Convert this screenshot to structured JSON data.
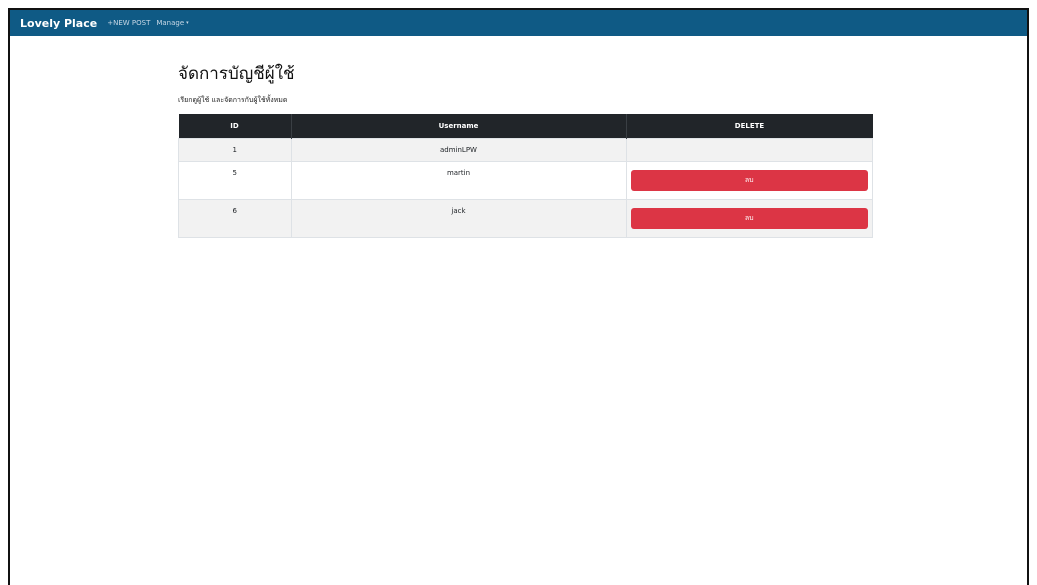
{
  "navbar": {
    "brand": "Lovely Place",
    "new_post": "+NEW POST",
    "manage": "Manage",
    "manage_caret": "▾"
  },
  "page": {
    "title": "จัดการบัญชีผู้ใช้",
    "subtitle": "เรียกดูผู้ใช้ และจัดการกับผู้ใช้ทั้งหมด"
  },
  "table": {
    "headers": [
      "ID",
      "Username",
      "DELETE"
    ],
    "rows": [
      {
        "id": "1",
        "username": "adminLPW",
        "delete_label": ""
      },
      {
        "id": "5",
        "username": "martin",
        "delete_label": "ลบ"
      },
      {
        "id": "6",
        "username": "jack",
        "delete_label": "ลบ"
      }
    ]
  },
  "colors": {
    "navbar": "#0f5a85",
    "table_header": "#212529",
    "delete_button": "#dc3545"
  }
}
